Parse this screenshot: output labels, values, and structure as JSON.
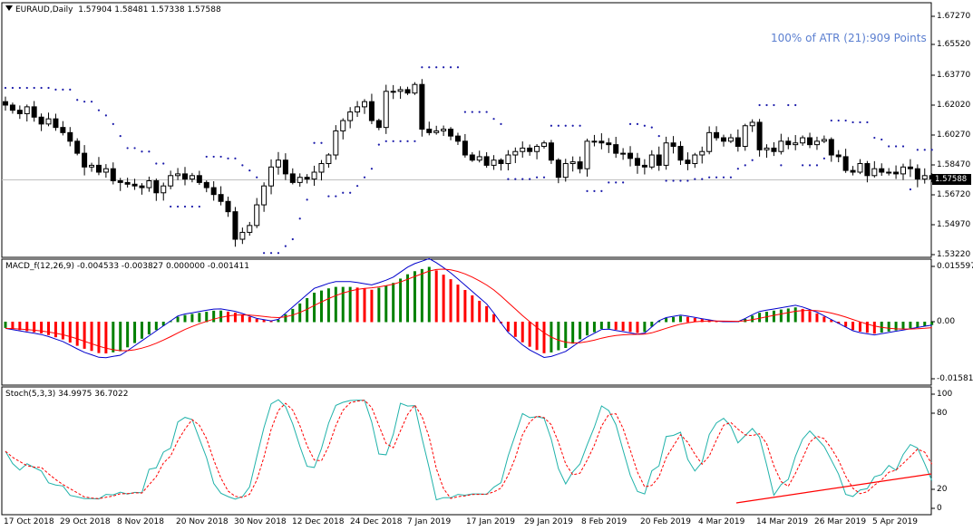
{
  "main_pane": {
    "symbol_label": "EURAUD,Daily",
    "ohlc": "1.57904 1.58481 1.57338 1.57588",
    "atr_text": "100% of ATR (21):909 Points",
    "current_price": "1.57588",
    "price_axis": [
      "1.67270",
      "1.65520",
      "1.63770",
      "1.62020",
      "1.60270",
      "1.58470",
      "1.56720",
      "1.54970",
      "1.53220"
    ],
    "current_price_value": 1.57588
  },
  "macd_pane": {
    "label": "MACD_f(12,26,9) -0.004533 -0.003827 0.000000 -0.001411",
    "axis": [
      "0.015597",
      "0.00",
      "-0.015811"
    ]
  },
  "stoch_pane": {
    "label": "Stoch(5,3,3) 34.9975 36.7022",
    "axis": [
      "100",
      "80",
      "20",
      "0"
    ]
  },
  "dates": [
    "17 Oct 2018",
    "29 Oct 2018",
    "8 Nov 2018",
    "20 Nov 2018",
    "30 Nov 2018",
    "12 Dec 2018",
    "24 Dec 2018",
    "7 Jan 2019",
    "17 Jan 2019",
    "29 Jan 2019",
    "8 Feb 2019",
    "20 Feb 2019",
    "4 Mar 2019",
    "14 Mar 2019",
    "26 Mar 2019",
    "5 Apr 2019"
  ],
  "colors": {
    "bull_hist": "#008000",
    "bear_hist": "#ff0000",
    "macd_line": "#0000cc",
    "signal_line": "#ff0000",
    "stoch_main": "#20b2aa",
    "stoch_signal": "#ff0000",
    "sar_dots": "#1a1aaa",
    "atr_text": "#5b7fd0",
    "trendline": "#ff0000"
  },
  "chart_data": {
    "type": "candlestick",
    "symbol": "EURAUD",
    "timeframe": "Daily",
    "closes": [
      1.619,
      1.616,
      1.614,
      1.618,
      1.612,
      1.608,
      1.611,
      1.606,
      1.603,
      1.598,
      1.591,
      1.583,
      1.584,
      1.58,
      1.582,
      1.575,
      1.574,
      1.573,
      1.572,
      1.571,
      1.575,
      1.568,
      1.572,
      1.578,
      1.579,
      1.576,
      1.578,
      1.574,
      1.571,
      1.567,
      1.563,
      1.557,
      1.541,
      1.545,
      1.549,
      1.561,
      1.572,
      1.583,
      1.587,
      1.579,
      1.574,
      1.577,
      1.576,
      1.58,
      1.585,
      1.59,
      1.604,
      1.61,
      1.615,
      1.618,
      1.621,
      1.61,
      1.606,
      1.627,
      1.627,
      1.628,
      1.626,
      1.631,
      1.605,
      1.603,
      1.604,
      1.605,
      1.601,
      1.598,
      1.59,
      1.587,
      1.589,
      1.584,
      1.587,
      1.585,
      1.59,
      1.592,
      1.594,
      1.592,
      1.595,
      1.597,
      1.587,
      1.577,
      1.585,
      1.586,
      1.582,
      1.598,
      1.598,
      1.597,
      1.596,
      1.591,
      1.591,
      1.588,
      1.584,
      1.583,
      1.59,
      1.584,
      1.597,
      1.595,
      1.587,
      1.585,
      1.59,
      1.592,
      1.603,
      1.6,
      1.598,
      1.6,
      1.595,
      1.607,
      1.609,
      1.593,
      1.594,
      1.592,
      1.598,
      1.596,
      1.597,
      1.6,
      1.596,
      1.598,
      1.599,
      1.59,
      1.589,
      1.581,
      1.58,
      1.585,
      1.578,
      1.582,
      1.58,
      1.58,
      1.579,
      1.583,
      1.582,
      1.576,
      1.578,
      1.576
    ],
    "macd_hist_sample": [
      -0.002,
      -0.003,
      -0.004,
      -0.006,
      -0.009,
      -0.011,
      -0.01,
      -0.006,
      -0.002,
      0.002,
      0.003,
      0.004,
      0.003,
      0.001,
      0.0,
      0.005,
      0.01,
      0.012,
      0.012,
      0.011,
      0.013,
      0.017,
      0.019,
      0.015,
      0.01,
      0.005,
      -0.003,
      -0.008,
      -0.011,
      -0.009,
      -0.005,
      -0.002,
      -0.003,
      -0.004,
      0.001,
      0.002,
      0.001,
      0.0,
      0.0,
      0.003,
      0.004,
      0.005,
      0.003,
      0.0,
      -0.003,
      -0.004,
      -0.003,
      -0.002,
      -0.001
    ],
    "stoch_range": [
      0,
      100
    ],
    "levels": [
      20,
      80
    ]
  }
}
